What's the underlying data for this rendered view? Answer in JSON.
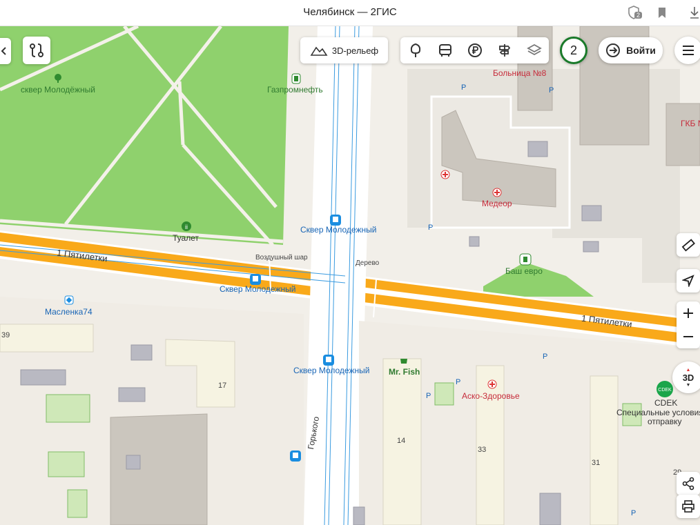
{
  "window": {
    "title": "Челябинск — 2ГИС",
    "notifications_badge": "2"
  },
  "toolbar": {
    "relief_label": "3D-рельеф",
    "login_label": "Войти",
    "counter": "2",
    "threed_label": "3D"
  },
  "map": {
    "park_top": "сквер Молодёжный",
    "gas_station": "Газпромнефть",
    "hospital8": "Больница №8",
    "gkb": "ГКБ N",
    "medeor": "Медеор",
    "toilet": "Туалет",
    "stop_top": "Сквер Молодежный",
    "balloon": "Воздушный шар",
    "tree": "Дерево",
    "street_left": "1 Пятилетки",
    "street_right": "1 Пятилетки",
    "stop_left": "Сквер Молодежный",
    "bash": "Баш евро",
    "maslenka": "Масленка74",
    "stop_bottom": "Сквер Молодежный",
    "mrfish": "Mr. Fish",
    "asko": "Аско-Здоровье",
    "cdek": "CDEK",
    "cdek_note1": "Специальные условия",
    "cdek_note2": "отправку",
    "gorkogo": "Горького",
    "h39": "39",
    "h17": "17",
    "h14": "14",
    "h33": "33",
    "h31": "31",
    "h29": "29",
    "parking": "P"
  }
}
